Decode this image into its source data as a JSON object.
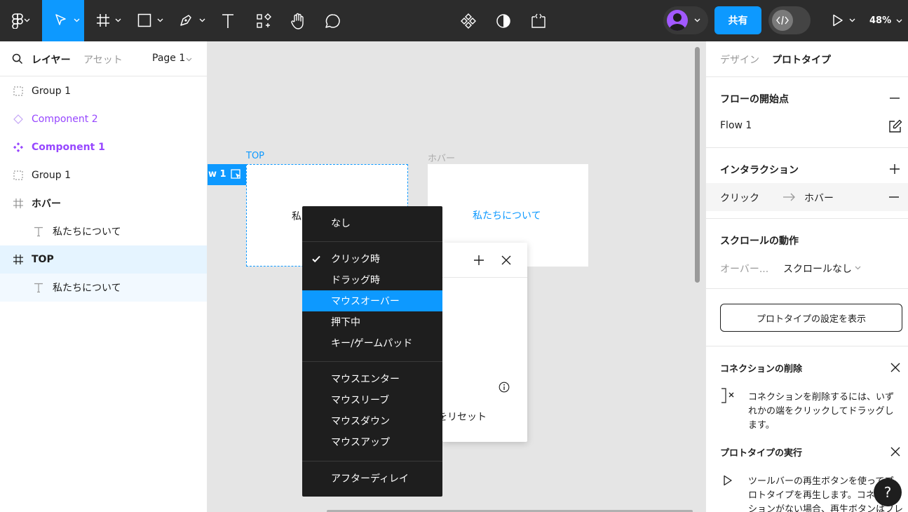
{
  "toolbar": {
    "share_label": "共有",
    "zoom_label": "48%"
  },
  "left_panel": {
    "tab_layers": "レイヤー",
    "tab_assets": "アセット",
    "page_selector": "Page 1",
    "layers": [
      {
        "label": "Group 1",
        "kind": "group"
      },
      {
        "label": "Component 2",
        "kind": "component-instance"
      },
      {
        "label": "Component 1",
        "kind": "component"
      },
      {
        "label": "Group 1",
        "kind": "group"
      },
      {
        "label": "ホバー",
        "kind": "frame"
      },
      {
        "label": "私たちについて",
        "kind": "text"
      },
      {
        "label": "TOP",
        "kind": "frame"
      },
      {
        "label": "私たちについて",
        "kind": "text"
      }
    ]
  },
  "canvas": {
    "frame_top_label": "TOP",
    "frame_hover_label": "ホバー",
    "flow_tag_label": "w 1",
    "frame_top_text": "私",
    "frame_hover_text": "私たちについて",
    "popover_reset_text": "をリセット"
  },
  "trigger_menu": {
    "items": [
      {
        "label": "なし"
      },
      {
        "label": "クリック時",
        "checked": true
      },
      {
        "label": "ドラッグ時"
      },
      {
        "label": "マウスオーバー",
        "highlighted": true
      },
      {
        "label": "押下中"
      },
      {
        "label": "キー/ゲームパッド"
      },
      {
        "label": "マウスエンター"
      },
      {
        "label": "マウスリーブ"
      },
      {
        "label": "マウスダウン"
      },
      {
        "label": "マウスアップ"
      },
      {
        "label": "アフターディレイ"
      }
    ]
  },
  "right_panel": {
    "tab_design": "デザイン",
    "tab_prototype": "プロトタイプ",
    "flow_start_title": "フローの開始点",
    "flow_name": "Flow 1",
    "interaction_title": "インタラクション",
    "interaction_trigger": "クリック",
    "interaction_target": "ホバー",
    "scroll_title": "スクロールの動作",
    "scroll_overflow_label": "オーバー...",
    "scroll_value": "スクロールなし",
    "prototype_settings_button": "プロトタイプの設定を表示",
    "delete_connection_title": "コネクションの削除",
    "delete_connection_text_1": "コネクションを削除するには、いず",
    "delete_connection_text_2": "れかの端をクリックしてドラッグし",
    "delete_connection_text_3": "ます。",
    "run_prototype_title": "プロトタイプの実行",
    "run_prototype_text_1": "ツールバーの再生ボタンを使ってプ",
    "run_prototype_text_2": "ロトタイプを再生します。コネク",
    "run_prototype_text_3": "ションがない場合、再生ボタンはフレ"
  },
  "help_label": "?",
  "colors": {
    "accent": "#0d99ff",
    "component_purple": "#9747ff",
    "toolbar_bg": "#2c2c2c"
  }
}
